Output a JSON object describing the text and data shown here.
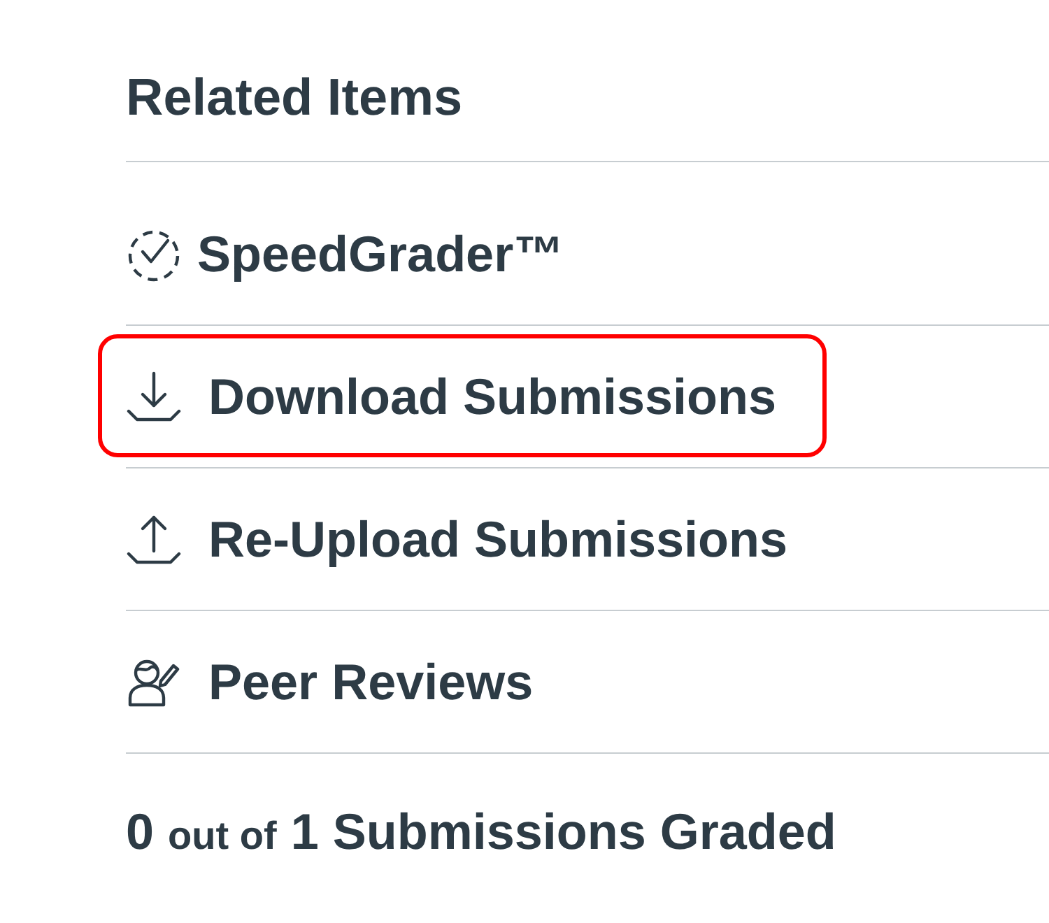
{
  "panel": {
    "title": "Related Items"
  },
  "items": [
    {
      "kind": "speedgrader",
      "label": "SpeedGrader™",
      "highlighted": false
    },
    {
      "kind": "download",
      "label": "Download Submissions",
      "highlighted": true
    },
    {
      "kind": "upload",
      "label": "Re-Upload Submissions",
      "highlighted": false
    },
    {
      "kind": "peer-review",
      "label": "Peer Reviews",
      "highlighted": false
    }
  ],
  "summary": {
    "graded": "0",
    "connector": "out of",
    "total": "1 Submissions Graded"
  }
}
